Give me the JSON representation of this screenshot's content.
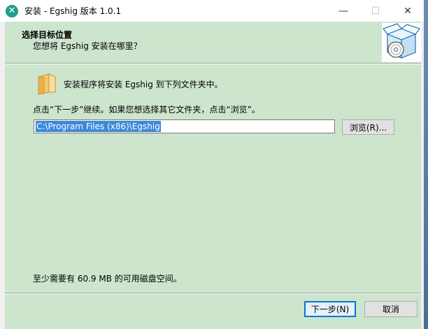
{
  "window": {
    "title": "安装 - Egshig 版本 1.0.1",
    "app_icon_glyph": "✕",
    "minimize_glyph": "—",
    "maximize_glyph": "☐",
    "close_glyph": "✕"
  },
  "header": {
    "title": "选择目标位置",
    "subtitle": "您想将 Egshig 安装在哪里？"
  },
  "content": {
    "install_info": "安装程序将安装 Egshig 到下列文件夹中。",
    "instruction": "点击“下一步”继续。如果您想选择其它文件夹，点击“浏览”。",
    "path_value": "C:\\Program Files (x86)\\Egshig",
    "browse_label": "浏览(R)...",
    "space_required": "至少需要有 60.9 MB 的可用磁盘空间。"
  },
  "footer": {
    "next_label": "下一步(N)",
    "cancel_label": "取消"
  },
  "icons": [
    "app-icon",
    "minimize-icon",
    "maximize-icon",
    "close-icon",
    "installer-box-icon",
    "folder-icon"
  ],
  "colors": {
    "panel_background": "#cde5cd",
    "app_icon": "#1f9e89",
    "selection": "#3c89d8",
    "default_button_border": "#0078d7"
  }
}
